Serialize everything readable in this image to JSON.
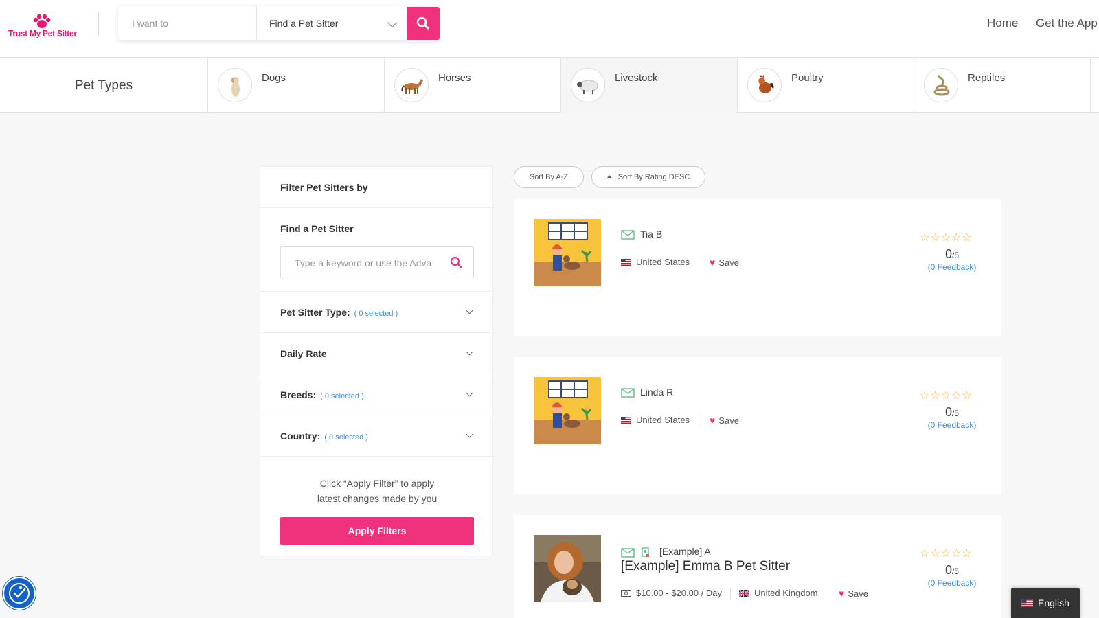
{
  "header": {
    "logo_text": "Trust My Pet Sitter",
    "search_placeholder": "I want to",
    "search_select": "Find a Pet Sitter",
    "nav": [
      "Home",
      "Get the App"
    ]
  },
  "pet_types": {
    "label": "Pet Types",
    "items": [
      {
        "name": "Dogs",
        "icon": "dog-icon"
      },
      {
        "name": "Horses",
        "icon": "horse-icon"
      },
      {
        "name": "Livestock",
        "icon": "sheep-icon"
      },
      {
        "name": "Poultry",
        "icon": "rooster-icon"
      },
      {
        "name": "Reptiles",
        "icon": "snake-icon"
      }
    ]
  },
  "filter": {
    "title": "Filter Pet Sitters by",
    "find_label": "Find a Pet Sitter",
    "find_placeholder": "Type a keyword or use the Adva",
    "pet_sitter_type": "Pet Sitter Type:",
    "pet_sitter_type_sel": "( 0 selected )",
    "daily_rate": "Daily Rate",
    "breeds": "Breeds:",
    "breeds_sel": "( 0 selected )",
    "country": "Country:",
    "country_sel": "( 0 selected )",
    "hint_line1": "Click “Apply Filter” to apply",
    "hint_line2": "latest changes made by you",
    "apply_label": "Apply Filters"
  },
  "sort": {
    "az_label": "Sort By A-Z",
    "rating_label": "Sort By Rating DESC"
  },
  "listings": [
    {
      "name": "Tia B",
      "country": "United States",
      "save": "Save",
      "score": "0",
      "out_of": "/5",
      "feedback": "(0 Feedback)"
    },
    {
      "name": "Linda R",
      "country": "United States",
      "save": "Save",
      "score": "0",
      "out_of": "/5",
      "feedback": "(0 Feedback)"
    },
    {
      "name": "[Example] A",
      "headline": "[Example] Emma B Pet Sitter",
      "rate": "$10.00 - $20.00 / Day",
      "country": "United Kingdom",
      "save": "Save",
      "score": "0",
      "out_of": "/5",
      "feedback": "(0 Feedback)"
    }
  ],
  "language": "English",
  "colors": {
    "accent": "#f0317b",
    "link": "#3b8fd9",
    "star": "#f3b53c"
  }
}
